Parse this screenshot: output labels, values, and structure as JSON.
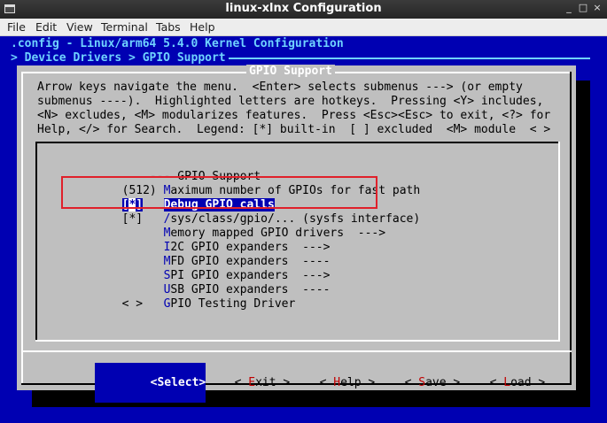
{
  "window": {
    "title": "linux-xlnx Configuration",
    "controls": [
      "_",
      "□",
      "×"
    ]
  },
  "menubar": [
    "File",
    "Edit",
    "View",
    "Terminal",
    "Tabs",
    "Help"
  ],
  "header": {
    "config_line": ".config - Linux/arm64 5.4.0 Kernel Configuration",
    "breadcrumb": "> Device Drivers > GPIO Support"
  },
  "dialog": {
    "title": "GPIO Support",
    "help_lines": [
      "Arrow keys navigate the menu.  <Enter> selects submenus ---> (or empty",
      "submenus ----).  Highlighted letters are hotkeys.  Pressing <Y> includes,",
      "<N> excludes, <M> modularizes features.  Press <Esc><Esc> to exit, <?> for",
      "Help, </> for Search.  Legend: [*] built-in  [ ] excluded  <M> module  < >"
    ]
  },
  "menu_items": [
    {
      "prefix": "    --- ",
      "hot": "",
      "rest": "GPIO Support"
    },
    {
      "prefix": "(512) ",
      "hot": "M",
      "rest": "aximum number of GPIOs for fast path",
      "hot_pos": "1"
    },
    {
      "prefix": "[*]   ",
      "hot": "",
      "rest": "Debug GPIO calls",
      "selected": true
    },
    {
      "prefix": "[*]   ",
      "hot": "/",
      "rest": "sys/class/gpio/... (sysfs interface)"
    },
    {
      "prefix": "      ",
      "hot": "M",
      "rest": "emory mapped GPIO drivers  --->"
    },
    {
      "prefix": "      ",
      "hot": "I",
      "rest": "2C GPIO expanders  --->"
    },
    {
      "prefix": "      ",
      "hot": "M",
      "rest": "FD GPIO expanders  ----"
    },
    {
      "prefix": "      ",
      "hot": "S",
      "rest": "PI GPIO expanders  --->"
    },
    {
      "prefix": "      ",
      "hot": "U",
      "rest": "SB GPIO expanders  ----"
    },
    {
      "prefix": "< >   ",
      "hot": "G",
      "rest": "PIO Testing Driver"
    }
  ],
  "buttons": {
    "select": {
      "pre": "<",
      "hk": "S",
      "post": "elect>"
    },
    "exit": {
      "pre": "< ",
      "hk": "E",
      "post": "xit >"
    },
    "help": {
      "pre": "< ",
      "hk": "H",
      "post": "elp >"
    },
    "save": {
      "pre": "< ",
      "hk": "S",
      "post": "ave >"
    },
    "load": {
      "pre": "< ",
      "hk": "L",
      "post": "oad >"
    }
  },
  "colors": {
    "background": "#0000b2",
    "dialog": "#bfbfbf",
    "header_text": "#6fd2ff",
    "hotkey": "#c00000",
    "annotation": "#e0202a"
  }
}
